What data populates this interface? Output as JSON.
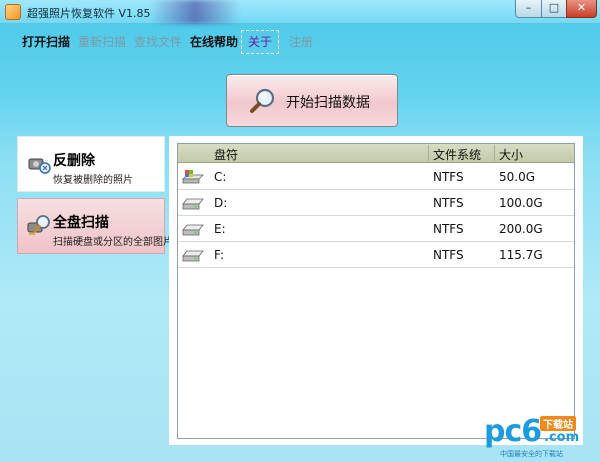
{
  "window": {
    "title": "超强照片恢复软件 V1.85",
    "minimize_glyph": "–",
    "maximize_glyph": "□",
    "close_glyph": "✕"
  },
  "menu": {
    "open_scan": "打开扫描",
    "rescan": "重新扫描",
    "find_file": "查找文件",
    "online_help": "在线帮助",
    "about": "关于",
    "register": "注册"
  },
  "start_button": {
    "label": "开始扫描数据",
    "icon": "magnifier-icon"
  },
  "modes": [
    {
      "title": "反删除",
      "desc": "恢复被删除的照片",
      "icon": "undelete-icon"
    },
    {
      "title": "全盘扫描",
      "desc": "扫描硬盘或分区的全部图片",
      "icon": "disk-scan-icon"
    }
  ],
  "table": {
    "headers": [
      "盘符",
      "文件系统",
      "大小"
    ],
    "rows": [
      {
        "drive": "C:",
        "fs": "NTFS",
        "size": "50.0G",
        "icon": "system-drive-icon"
      },
      {
        "drive": "D:",
        "fs": "NTFS",
        "size": "100.0G",
        "icon": "drive-icon"
      },
      {
        "drive": "E:",
        "fs": "NTFS",
        "size": "200.0G",
        "icon": "drive-icon"
      },
      {
        "drive": "F:",
        "fs": "NTFS",
        "size": "115.7G",
        "icon": "drive-icon"
      }
    ]
  },
  "watermark": {
    "brand": "pc6",
    "badge": "下载站",
    "domain": ".com",
    "sub": "中国最安全的下载站"
  },
  "colors": {
    "accent_blue": "#49c8e8",
    "selected_mode_pink": "#efc3c8",
    "header_olive": "#c3cba8",
    "about_purple": "#6a1ea0"
  }
}
